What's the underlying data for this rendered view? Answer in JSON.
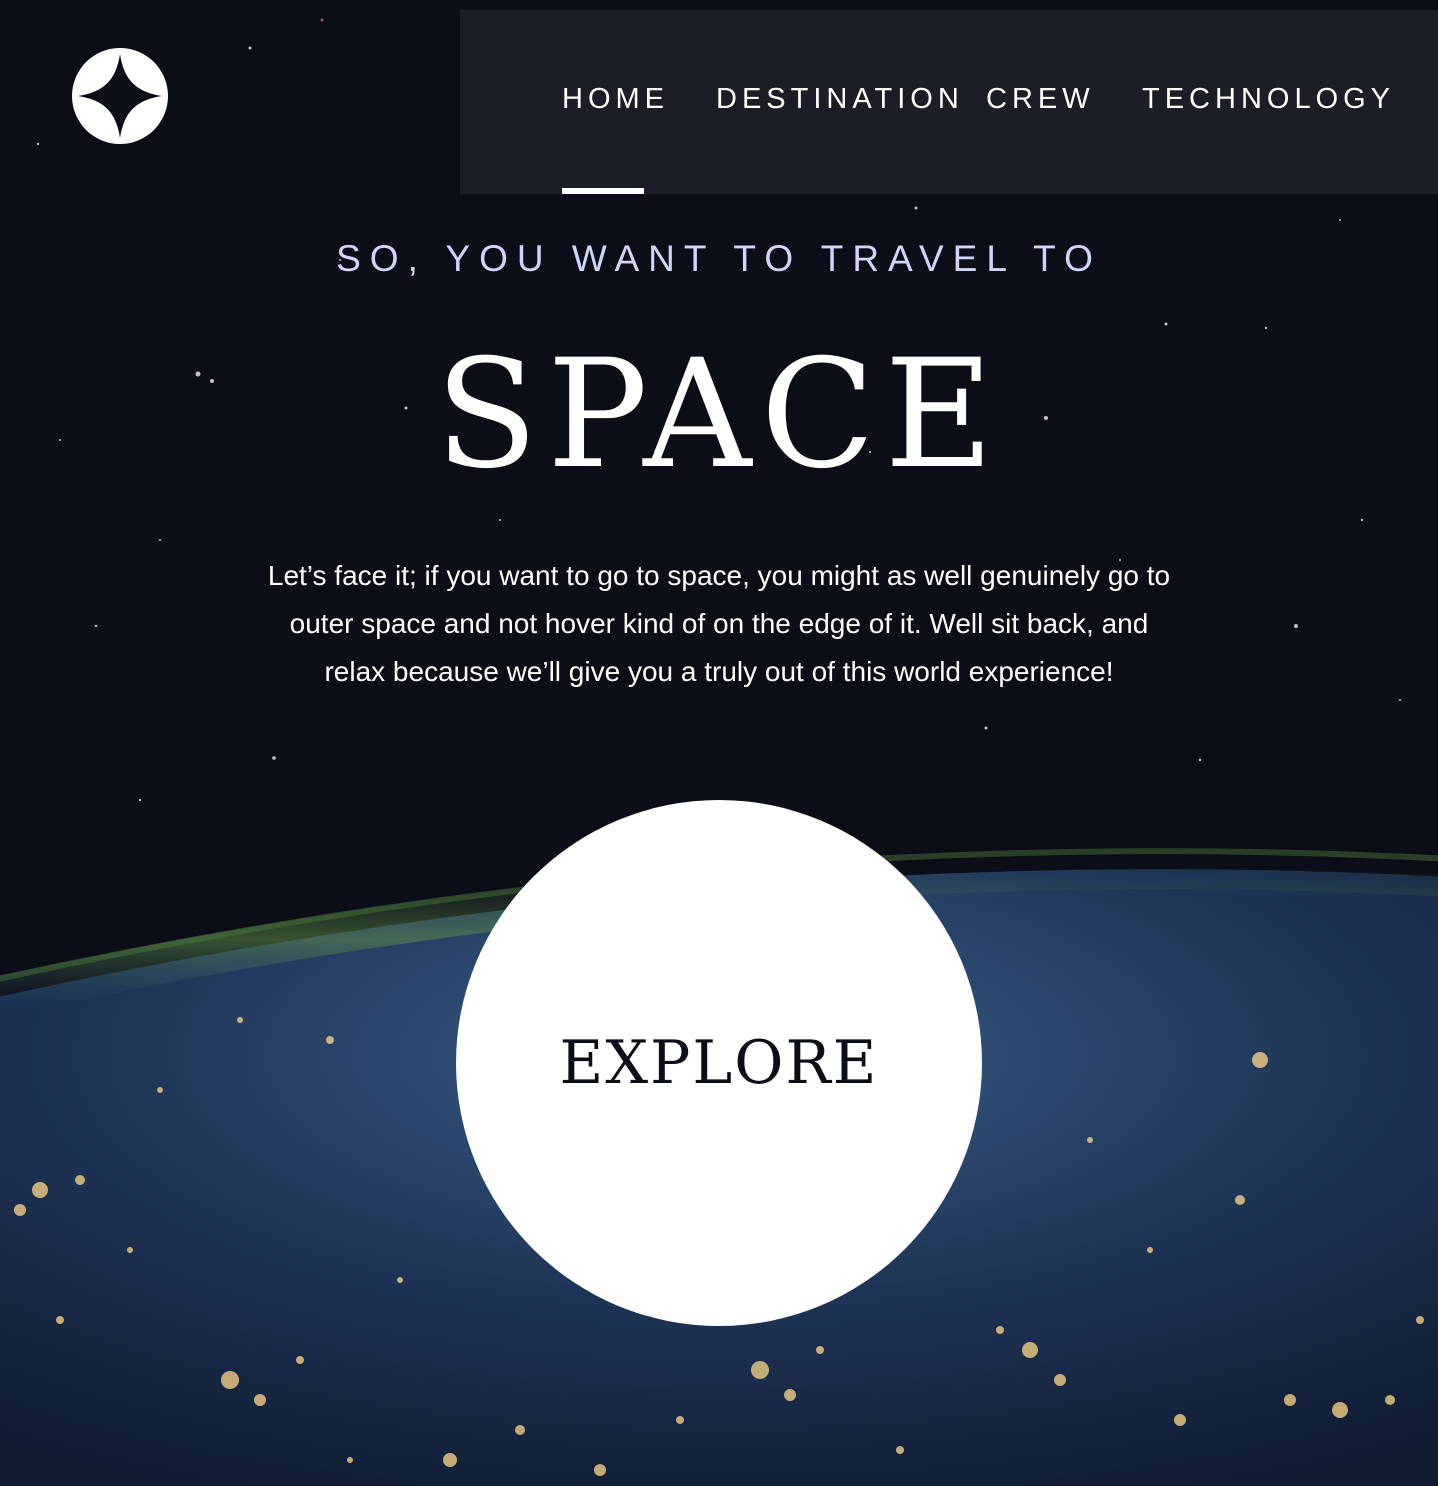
{
  "header": {
    "logo_icon": "four-point-star-icon",
    "nav": [
      {
        "label": "HOME",
        "active": true
      },
      {
        "label": "DESTINATION",
        "active": false
      },
      {
        "label": "CREW",
        "active": false
      },
      {
        "label": "TECHNOLOGY",
        "active": false
      }
    ]
  },
  "hero": {
    "kicker": "SO, YOU WANT TO TRAVEL TO",
    "title": "SPACE",
    "body": "Let’s face it; if you want to go to space, you might as well genuinely go to outer space and not hover kind of on the edge of it. Well sit back, and relax because we’ll give you a truly out of this world experience!",
    "cta_label": "EXPLORE"
  },
  "colors": {
    "background": "#0b0d17",
    "nav_background": "#1c1f29",
    "accent_light": "#d0d6f9",
    "white": "#ffffff"
  }
}
